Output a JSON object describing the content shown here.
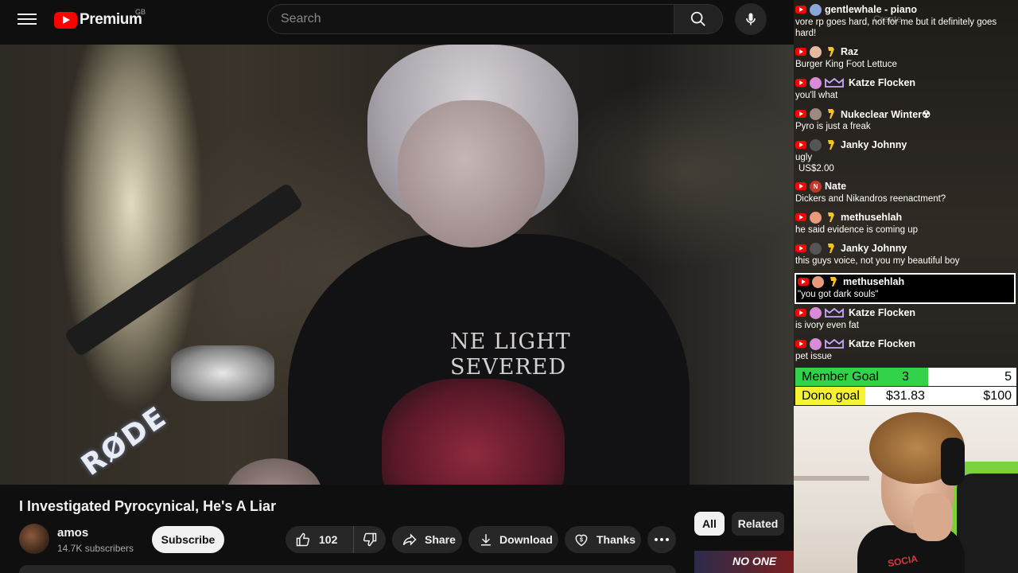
{
  "header": {
    "logo_text": "Premium",
    "country_code": "GB",
    "search_placeholder": "Search",
    "create_label": "Create"
  },
  "video": {
    "shirt_text_line1": "NE LIGHT",
    "shirt_text_line2": "SEVERED",
    "mic_brand": "RØDE",
    "title": "I Investigated Pyrocynical, He's A Liar",
    "channel_name": "amos",
    "subscribers": "14.7K subscribers",
    "subscribe_label": "Subscribe",
    "like_count": "102",
    "share_label": "Share",
    "download_label": "Download",
    "thanks_label": "Thanks"
  },
  "filters": {
    "all_label": "All",
    "related_label": "Related"
  },
  "related_thumb_text": "NO ONE",
  "chat": {
    "messages": [
      {
        "name": "gentlewhale - piano",
        "text": "vore rp goes hard, not for me but it definitely goes hard!",
        "avatar_color": "#8aa6d8",
        "badge": "none"
      },
      {
        "name": "Raz",
        "text": "Burger King Foot Lettuce",
        "avatar_color": "#e8b8a0",
        "badge": "member"
      },
      {
        "name": "Katze Flocken",
        "text": "you'll what",
        "avatar_color": "#d98ad8",
        "badge": "crown"
      },
      {
        "name": "Nukeclear Winter☢",
        "text": "Pyro is just a freak",
        "avatar_color": "#9a8a80",
        "badge": "member"
      },
      {
        "name": "Janky Johnny",
        "text": "ugly",
        "avatar_color": "#555555",
        "badge": "member",
        "superchat": "US$2.00"
      },
      {
        "name": "Nate",
        "text": "Dickers and Nikandros reenactment?",
        "avatar_color": "#c0392b",
        "badge": "none",
        "avatar_letter": "N"
      },
      {
        "name": "methusehlah",
        "text": "he said evidence is coming up",
        "avatar_color": "#e89a7a",
        "badge": "member"
      },
      {
        "name": "Janky Johnny",
        "text": "this guys voice, not you my beautiful boy",
        "avatar_color": "#555555",
        "badge": "member"
      },
      {
        "name": "methusehlah",
        "text": "\"you got dark souls\"",
        "avatar_color": "#e89a7a",
        "badge": "member"
      },
      {
        "name": "Katze Flocken",
        "text": "is ivory even fat",
        "avatar_color": "#d98ad8",
        "badge": "crown"
      },
      {
        "name": "Katze Flocken",
        "text": "pet issue",
        "avatar_color": "#d98ad8",
        "badge": "crown"
      }
    ]
  },
  "goals": {
    "member_label": "Member Goal",
    "member_current": "3",
    "member_target": "5",
    "member_progress": 0.6,
    "dono_label": "Dono goal",
    "dono_current": "$31.83",
    "dono_target": "$100",
    "dono_progress": 0.318
  },
  "webcam": {
    "shirt_text": "SOCIA"
  },
  "colors": {
    "youtube_red": "#ff0000",
    "member_goal_fill": "#33d24b",
    "dono_goal_fill": "#f5f232",
    "highlight_border": "#ffffff"
  }
}
